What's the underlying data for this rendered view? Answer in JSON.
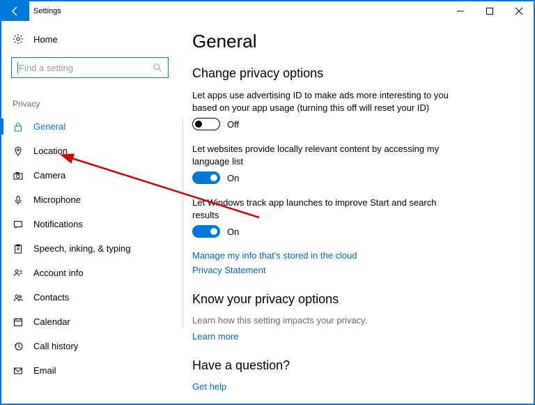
{
  "titlebar": {
    "title": "Settings"
  },
  "sidebar": {
    "home_label": "Home",
    "search_placeholder": "Find a setting",
    "section": "Privacy",
    "items": [
      {
        "label": "General"
      },
      {
        "label": "Location"
      },
      {
        "label": "Camera"
      },
      {
        "label": "Microphone"
      },
      {
        "label": "Notifications"
      },
      {
        "label": "Speech, inking, & typing"
      },
      {
        "label": "Account info"
      },
      {
        "label": "Contacts"
      },
      {
        "label": "Calendar"
      },
      {
        "label": "Call history"
      },
      {
        "label": "Email"
      }
    ]
  },
  "content": {
    "page_title": "General",
    "h2_a": "Change privacy options",
    "opt1_desc": "Let apps use advertising ID to make ads more interesting to you based on your app usage (turning this off will reset your ID)",
    "opt1_state": "Off",
    "opt2_desc": "Let websites provide locally relevant content by accessing my language list",
    "opt2_state": "On",
    "opt3_desc": "Let Windows track app launches to improve Start and search results",
    "opt3_state": "On",
    "link1": "Manage my info that's stored in the cloud",
    "link2": "Privacy Statement",
    "h2_b": "Know your privacy options",
    "sub_b": "Learn how this setting impacts your privacy.",
    "link3": "Learn more",
    "h2_c": "Have a question?",
    "link4": "Get help"
  }
}
